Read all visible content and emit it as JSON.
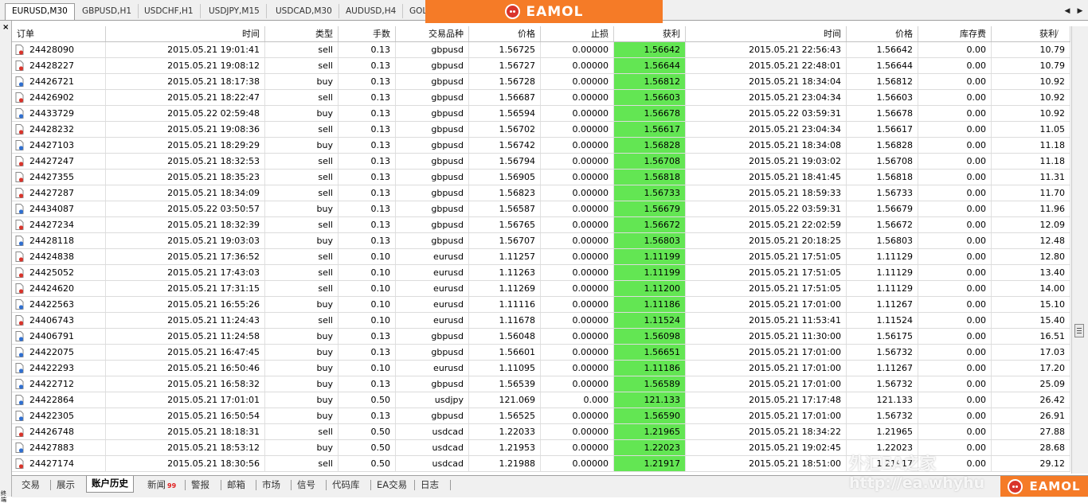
{
  "chart_tabs": [
    {
      "label": "EURUSD,M30",
      "active": true
    },
    {
      "label": "GBPUSD,H1",
      "active": false
    },
    {
      "label": "USDCHF,H1",
      "active": false
    },
    {
      "label": "USDJPY,M15",
      "active": false
    },
    {
      "label": "USDCAD,M30",
      "active": false
    },
    {
      "label": "AUDUSD,H4",
      "active": false
    },
    {
      "label": "GOL",
      "active": false
    }
  ],
  "logo_text": "EAMOL",
  "watermark": {
    "line1": "外汇EA之家",
    "line2": "http://ea.whyhu"
  },
  "left_strip": {
    "close": "×",
    "label": "终端"
  },
  "table": {
    "headers": [
      "订单",
      "时间",
      "类型",
      "手数",
      "交易品种",
      "价格",
      "止损",
      "获利",
      "时间",
      "价格",
      "库存费",
      "获利"
    ],
    "sort_indicator": "/",
    "rows": [
      {
        "order": "24428090",
        "open_time": "2015.05.21 19:01:41",
        "type": "sell",
        "lots": "0.13",
        "symbol": "gbpusd",
        "open_price": "1.56725",
        "sl": "0.00000",
        "tp": "1.56642",
        "close_time": "2015.05.21 22:56:43",
        "close_price": "1.56642",
        "swap": "0.00",
        "profit": "10.79"
      },
      {
        "order": "24428227",
        "open_time": "2015.05.21 19:08:12",
        "type": "sell",
        "lots": "0.13",
        "symbol": "gbpusd",
        "open_price": "1.56727",
        "sl": "0.00000",
        "tp": "1.56644",
        "close_time": "2015.05.21 22:48:01",
        "close_price": "1.56644",
        "swap": "0.00",
        "profit": "10.79"
      },
      {
        "order": "24426721",
        "open_time": "2015.05.21 18:17:38",
        "type": "buy",
        "lots": "0.13",
        "symbol": "gbpusd",
        "open_price": "1.56728",
        "sl": "0.00000",
        "tp": "1.56812",
        "close_time": "2015.05.21 18:34:04",
        "close_price": "1.56812",
        "swap": "0.00",
        "profit": "10.92"
      },
      {
        "order": "24426902",
        "open_time": "2015.05.21 18:22:47",
        "type": "sell",
        "lots": "0.13",
        "symbol": "gbpusd",
        "open_price": "1.56687",
        "sl": "0.00000",
        "tp": "1.56603",
        "close_time": "2015.05.21 23:04:34",
        "close_price": "1.56603",
        "swap": "0.00",
        "profit": "10.92"
      },
      {
        "order": "24433729",
        "open_time": "2015.05.22 02:59:48",
        "type": "buy",
        "lots": "0.13",
        "symbol": "gbpusd",
        "open_price": "1.56594",
        "sl": "0.00000",
        "tp": "1.56678",
        "close_time": "2015.05.22 03:59:31",
        "close_price": "1.56678",
        "swap": "0.00",
        "profit": "10.92"
      },
      {
        "order": "24428232",
        "open_time": "2015.05.21 19:08:36",
        "type": "sell",
        "lots": "0.13",
        "symbol": "gbpusd",
        "open_price": "1.56702",
        "sl": "0.00000",
        "tp": "1.56617",
        "close_time": "2015.05.21 23:04:34",
        "close_price": "1.56617",
        "swap": "0.00",
        "profit": "11.05"
      },
      {
        "order": "24427103",
        "open_time": "2015.05.21 18:29:29",
        "type": "buy",
        "lots": "0.13",
        "symbol": "gbpusd",
        "open_price": "1.56742",
        "sl": "0.00000",
        "tp": "1.56828",
        "close_time": "2015.05.21 18:34:08",
        "close_price": "1.56828",
        "swap": "0.00",
        "profit": "11.18"
      },
      {
        "order": "24427247",
        "open_time": "2015.05.21 18:32:53",
        "type": "sell",
        "lots": "0.13",
        "symbol": "gbpusd",
        "open_price": "1.56794",
        "sl": "0.00000",
        "tp": "1.56708",
        "close_time": "2015.05.21 19:03:02",
        "close_price": "1.56708",
        "swap": "0.00",
        "profit": "11.18"
      },
      {
        "order": "24427355",
        "open_time": "2015.05.21 18:35:23",
        "type": "sell",
        "lots": "0.13",
        "symbol": "gbpusd",
        "open_price": "1.56905",
        "sl": "0.00000",
        "tp": "1.56818",
        "close_time": "2015.05.21 18:41:45",
        "close_price": "1.56818",
        "swap": "0.00",
        "profit": "11.31"
      },
      {
        "order": "24427287",
        "open_time": "2015.05.21 18:34:09",
        "type": "sell",
        "lots": "0.13",
        "symbol": "gbpusd",
        "open_price": "1.56823",
        "sl": "0.00000",
        "tp": "1.56733",
        "close_time": "2015.05.21 18:59:33",
        "close_price": "1.56733",
        "swap": "0.00",
        "profit": "11.70"
      },
      {
        "order": "24434087",
        "open_time": "2015.05.22 03:50:57",
        "type": "buy",
        "lots": "0.13",
        "symbol": "gbpusd",
        "open_price": "1.56587",
        "sl": "0.00000",
        "tp": "1.56679",
        "close_time": "2015.05.22 03:59:31",
        "close_price": "1.56679",
        "swap": "0.00",
        "profit": "11.96"
      },
      {
        "order": "24427234",
        "open_time": "2015.05.21 18:32:39",
        "type": "sell",
        "lots": "0.13",
        "symbol": "gbpusd",
        "open_price": "1.56765",
        "sl": "0.00000",
        "tp": "1.56672",
        "close_time": "2015.05.21 22:02:59",
        "close_price": "1.56672",
        "swap": "0.00",
        "profit": "12.09"
      },
      {
        "order": "24428118",
        "open_time": "2015.05.21 19:03:03",
        "type": "buy",
        "lots": "0.13",
        "symbol": "gbpusd",
        "open_price": "1.56707",
        "sl": "0.00000",
        "tp": "1.56803",
        "close_time": "2015.05.21 20:18:25",
        "close_price": "1.56803",
        "swap": "0.00",
        "profit": "12.48"
      },
      {
        "order": "24424838",
        "open_time": "2015.05.21 17:36:52",
        "type": "sell",
        "lots": "0.10",
        "symbol": "eurusd",
        "open_price": "1.11257",
        "sl": "0.00000",
        "tp": "1.11199",
        "close_time": "2015.05.21 17:51:05",
        "close_price": "1.11129",
        "swap": "0.00",
        "profit": "12.80"
      },
      {
        "order": "24425052",
        "open_time": "2015.05.21 17:43:03",
        "type": "sell",
        "lots": "0.10",
        "symbol": "eurusd",
        "open_price": "1.11263",
        "sl": "0.00000",
        "tp": "1.11199",
        "close_time": "2015.05.21 17:51:05",
        "close_price": "1.11129",
        "swap": "0.00",
        "profit": "13.40"
      },
      {
        "order": "24424620",
        "open_time": "2015.05.21 17:31:15",
        "type": "sell",
        "lots": "0.10",
        "symbol": "eurusd",
        "open_price": "1.11269",
        "sl": "0.00000",
        "tp": "1.11200",
        "close_time": "2015.05.21 17:51:05",
        "close_price": "1.11129",
        "swap": "0.00",
        "profit": "14.00"
      },
      {
        "order": "24422563",
        "open_time": "2015.05.21 16:55:26",
        "type": "buy",
        "lots": "0.10",
        "symbol": "eurusd",
        "open_price": "1.11116",
        "sl": "0.00000",
        "tp": "1.11186",
        "close_time": "2015.05.21 17:01:00",
        "close_price": "1.11267",
        "swap": "0.00",
        "profit": "15.10"
      },
      {
        "order": "24406743",
        "open_time": "2015.05.21 11:24:43",
        "type": "sell",
        "lots": "0.10",
        "symbol": "eurusd",
        "open_price": "1.11678",
        "sl": "0.00000",
        "tp": "1.11524",
        "close_time": "2015.05.21 11:53:41",
        "close_price": "1.11524",
        "swap": "0.00",
        "profit": "15.40"
      },
      {
        "order": "24406791",
        "open_time": "2015.05.21 11:24:58",
        "type": "buy",
        "lots": "0.13",
        "symbol": "gbpusd",
        "open_price": "1.56048",
        "sl": "0.00000",
        "tp": "1.56098",
        "close_time": "2015.05.21 11:30:00",
        "close_price": "1.56175",
        "swap": "0.00",
        "profit": "16.51"
      },
      {
        "order": "24422075",
        "open_time": "2015.05.21 16:47:45",
        "type": "buy",
        "lots": "0.13",
        "symbol": "gbpusd",
        "open_price": "1.56601",
        "sl": "0.00000",
        "tp": "1.56651",
        "close_time": "2015.05.21 17:01:00",
        "close_price": "1.56732",
        "swap": "0.00",
        "profit": "17.03"
      },
      {
        "order": "24422293",
        "open_time": "2015.05.21 16:50:46",
        "type": "buy",
        "lots": "0.10",
        "symbol": "eurusd",
        "open_price": "1.11095",
        "sl": "0.00000",
        "tp": "1.11186",
        "close_time": "2015.05.21 17:01:00",
        "close_price": "1.11267",
        "swap": "0.00",
        "profit": "17.20"
      },
      {
        "order": "24422712",
        "open_time": "2015.05.21 16:58:32",
        "type": "buy",
        "lots": "0.13",
        "symbol": "gbpusd",
        "open_price": "1.56539",
        "sl": "0.00000",
        "tp": "1.56589",
        "close_time": "2015.05.21 17:01:00",
        "close_price": "1.56732",
        "swap": "0.00",
        "profit": "25.09"
      },
      {
        "order": "24422864",
        "open_time": "2015.05.21 17:01:01",
        "type": "buy",
        "lots": "0.50",
        "symbol": "usdjpy",
        "open_price": "121.069",
        "sl": "0.000",
        "tp": "121.133",
        "close_time": "2015.05.21 17:17:48",
        "close_price": "121.133",
        "swap": "0.00",
        "profit": "26.42"
      },
      {
        "order": "24422305",
        "open_time": "2015.05.21 16:50:54",
        "type": "buy",
        "lots": "0.13",
        "symbol": "gbpusd",
        "open_price": "1.56525",
        "sl": "0.00000",
        "tp": "1.56590",
        "close_time": "2015.05.21 17:01:00",
        "close_price": "1.56732",
        "swap": "0.00",
        "profit": "26.91"
      },
      {
        "order": "24426748",
        "open_time": "2015.05.21 18:18:31",
        "type": "sell",
        "lots": "0.50",
        "symbol": "usdcad",
        "open_price": "1.22033",
        "sl": "0.00000",
        "tp": "1.21965",
        "close_time": "2015.05.21 18:34:22",
        "close_price": "1.21965",
        "swap": "0.00",
        "profit": "27.88"
      },
      {
        "order": "24427883",
        "open_time": "2015.05.21 18:53:12",
        "type": "buy",
        "lots": "0.50",
        "symbol": "usdcad",
        "open_price": "1.21953",
        "sl": "0.00000",
        "tp": "1.22023",
        "close_time": "2015.05.21 19:02:45",
        "close_price": "1.22023",
        "swap": "0.00",
        "profit": "28.68"
      },
      {
        "order": "24427174",
        "open_time": "2015.05.21 18:30:56",
        "type": "sell",
        "lots": "0.50",
        "symbol": "usdcad",
        "open_price": "1.21988",
        "sl": "0.00000",
        "tp": "1.21917",
        "close_time": "2015.05.21 18:51:00",
        "close_price": "1.21917",
        "swap": "0.00",
        "profit": "29.12"
      }
    ]
  },
  "bottom_tabs": [
    {
      "label": "交易",
      "active": false
    },
    {
      "label": "展示",
      "active": false
    },
    {
      "label": "账户历史",
      "active": true
    },
    {
      "label": "新闻",
      "badge": "99",
      "active": false
    },
    {
      "label": "警报",
      "active": false
    },
    {
      "label": "邮箱",
      "active": false
    },
    {
      "label": "市场",
      "active": false
    },
    {
      "label": "信号",
      "active": false
    },
    {
      "label": "代码库",
      "active": false
    },
    {
      "label": "EA交易",
      "active": false
    },
    {
      "label": "日志",
      "active": false
    }
  ],
  "colors": {
    "tp_highlight": "#63e653",
    "logo_bg": "#f57b27",
    "sell_icon": "#d9342b",
    "buy_icon": "#2f6fd0"
  }
}
